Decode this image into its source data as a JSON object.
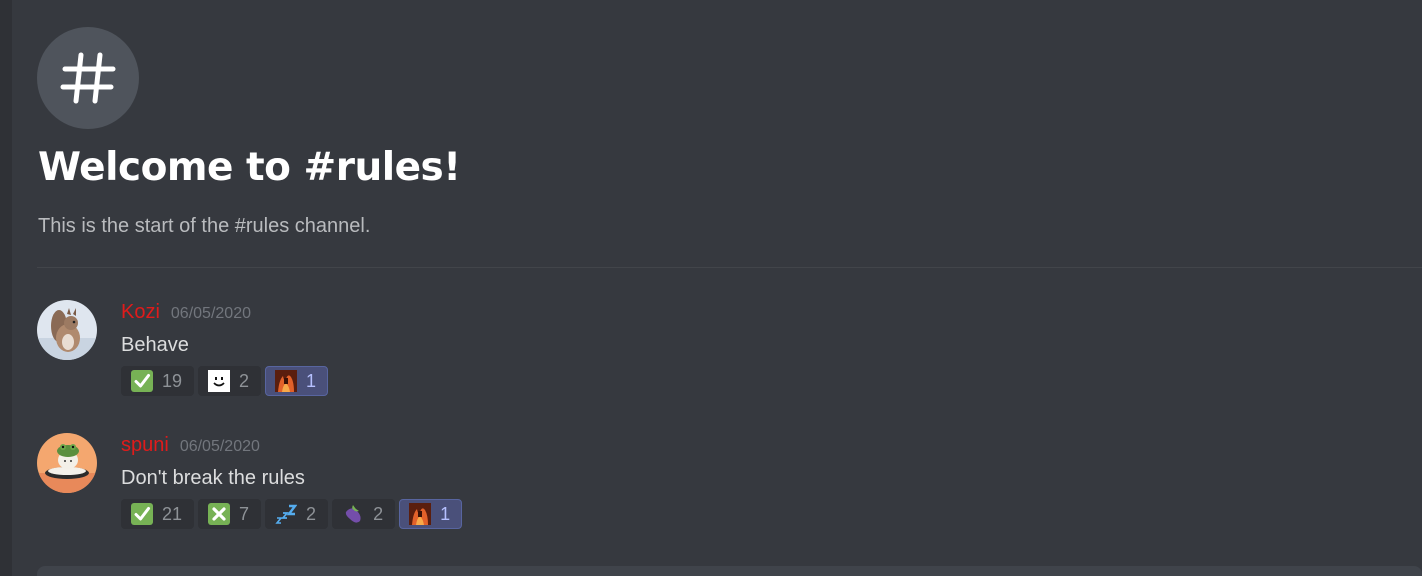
{
  "channel": {
    "icon": "hash-icon",
    "welcome_title": "Welcome to #rules!",
    "welcome_subtitle": "This is the start of the #rules channel."
  },
  "messages": [
    {
      "username": "Kozi",
      "timestamp": "06/05/2020",
      "text": "Behave",
      "avatar": "squirrel-avatar",
      "reactions": [
        {
          "emoji": "check-mark-icon",
          "count": "19",
          "me": false
        },
        {
          "emoji": "smiley-face-icon",
          "count": "2",
          "me": false
        },
        {
          "emoji": "custom-fire-emoji-icon",
          "count": "1",
          "me": true
        }
      ]
    },
    {
      "username": "spuni",
      "timestamp": "06/05/2020",
      "text": "Don't break the rules",
      "avatar": "frog-hat-avatar",
      "reactions": [
        {
          "emoji": "check-mark-icon",
          "count": "21",
          "me": false
        },
        {
          "emoji": "cross-mark-icon",
          "count": "7",
          "me": false
        },
        {
          "emoji": "zzz-icon",
          "count": "2",
          "me": false
        },
        {
          "emoji": "eggplant-icon",
          "count": "2",
          "me": false
        },
        {
          "emoji": "custom-fire-emoji-icon",
          "count": "1",
          "me": true
        }
      ]
    }
  ],
  "colors": {
    "background": "#36393f",
    "username": "#e01b1b",
    "reaction_me": "#4a507a"
  }
}
